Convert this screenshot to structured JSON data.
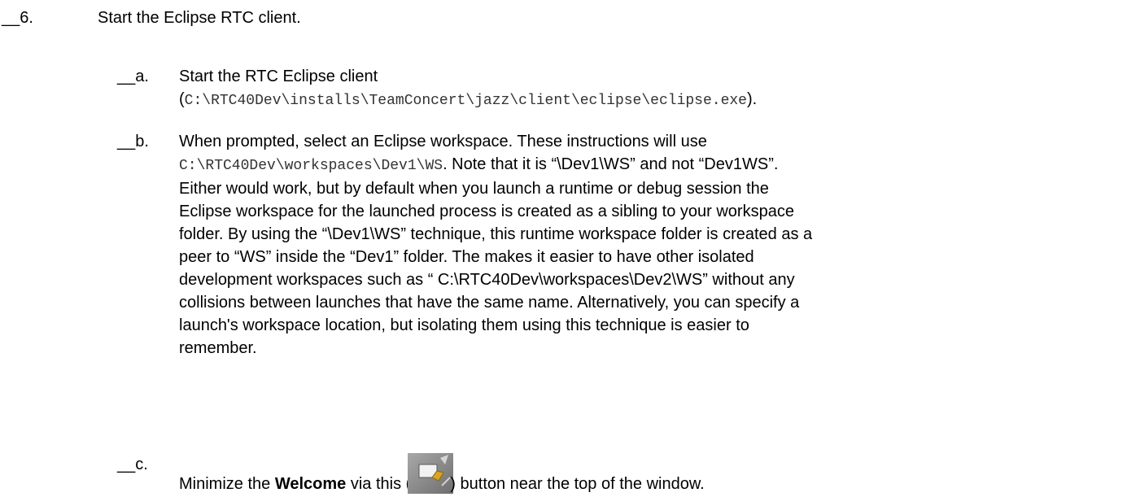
{
  "step": {
    "number": "__6.",
    "text": "Start the Eclipse RTC client."
  },
  "substeps": [
    {
      "letter": "__a.",
      "line1": "Start the RTC Eclipse client",
      "paren_open": "(",
      "path": "C:\\RTC40Dev\\installs\\TeamConcert\\jazz\\client\\eclipse\\eclipse.exe",
      "paren_close": ")."
    },
    {
      "letter": "__b.",
      "intro": "When prompted, select an Eclipse workspace. These instructions will use",
      "path": "C:\\RTC40Dev\\workspaces\\Dev1\\WS",
      "after_path": ". Note that it is “\\Dev1\\WS” and not “Dev1WS”.",
      "lines": [
        "Either would work, but by default when you launch a runtime or debug session the",
        "Eclipse workspace for the launched process is created as a sibling to your workspace",
        "folder. By using the “\\Dev1\\WS” technique, this runtime workspace folder is created as a",
        "peer to “WS” inside the “Dev1” folder. The makes it easier to have other isolated",
        "development workspaces such as “ C:\\RTC40Dev\\workspaces\\Dev2\\WS” without any",
        "collisions between launches that have the same name. Alternatively, you can specify a",
        "launch's workspace location, but isolating them using this technique is easier to",
        "remember."
      ]
    },
    {
      "letter": "__c.",
      "before_bold": "Minimize the ",
      "bold": "Welcome",
      "before_icon": " via this (",
      "icon": "minimize-welcome-icon",
      "after_icon": ") button near the top of the window."
    }
  ],
  "colors": {
    "text": "#000000",
    "mono_text": "#333333",
    "icon_bg": "#8c8c8c",
    "icon_fold": "#d9a520"
  }
}
